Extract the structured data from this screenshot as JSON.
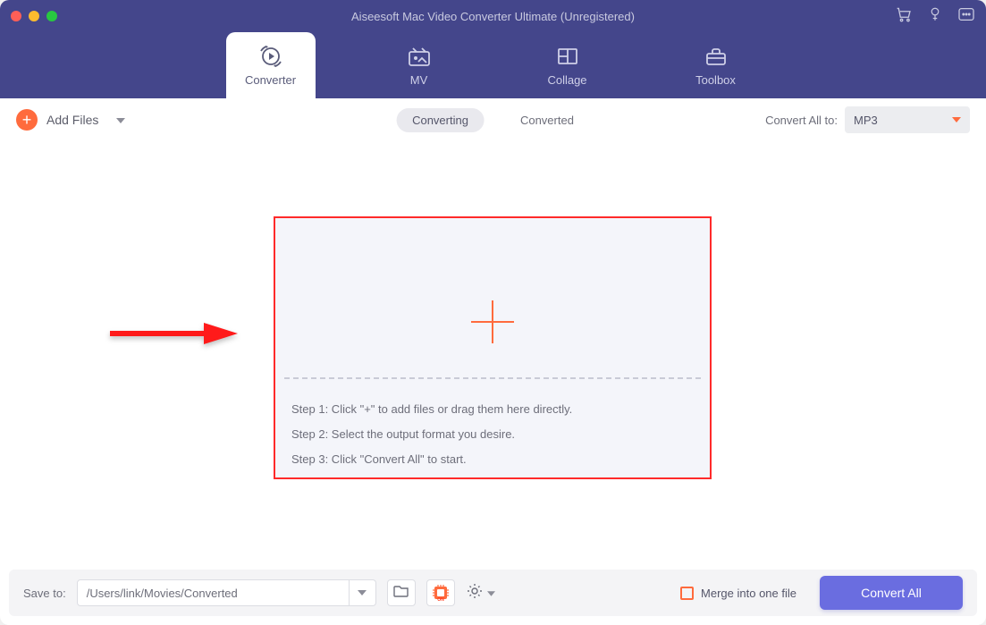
{
  "window": {
    "title": "Aiseesoft Mac Video Converter Ultimate (Unregistered)"
  },
  "nav": {
    "converter": "Converter",
    "mv": "MV",
    "collage": "Collage",
    "toolbox": "Toolbox"
  },
  "toolbar": {
    "add_files": "Add Files",
    "converting": "Converting",
    "converted": "Converted",
    "convert_all_to": "Convert All to:",
    "format": "MP3"
  },
  "drop": {
    "step1": "Step 1: Click \"+\" to add files or drag them here directly.",
    "step2": "Step 2: Select the output format you desire.",
    "step3": "Step 3: Click \"Convert All\" to start."
  },
  "bottom": {
    "save_to": "Save to:",
    "path": "/Users/link/Movies/Converted",
    "merge": "Merge into one file",
    "convert_all": "Convert All"
  }
}
